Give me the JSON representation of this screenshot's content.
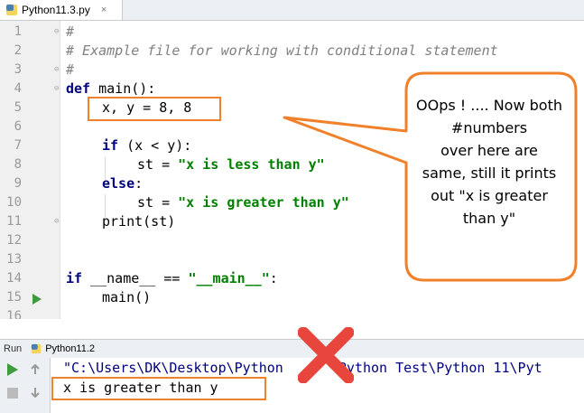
{
  "tab": {
    "filename": "Python11.3.py",
    "close_glyph": "×"
  },
  "editor": {
    "line_numbers": [
      "1",
      "2",
      "3",
      "4",
      "5",
      "6",
      "7",
      "8",
      "9",
      "10",
      "11",
      "12",
      "13",
      "14",
      "15",
      "16"
    ]
  },
  "code": {
    "l1": "#",
    "l2": "# Example file for working with conditional statement",
    "l3": "#",
    "l4_kw": "def",
    "l4_rest": " main():",
    "l5": "x, y = 8, 8",
    "l7_kw": "if",
    "l7_rest": " (x < y):",
    "l8_pre": "st = ",
    "l8_str": "\"x is less than y\"",
    "l9_kw": "else",
    "l9_rest": ":",
    "l10_pre": "st = ",
    "l10_str": "\"x is greater than y\"",
    "l11": "print(st)",
    "l14_kw": "if",
    "l14_mid": " __name__ == ",
    "l14_str": "\"__main__\"",
    "l14_end": ":",
    "l15": "main()"
  },
  "annotation": {
    "text_lines": [
      "OOps ! .... Now both",
      "#numbers",
      "over here are",
      "same, still it prints",
      "out \"x is greater",
      "than y\""
    ],
    "accent_color": "#f0802a"
  },
  "run_panel": {
    "label": "Run",
    "config": "Python11.2",
    "command": "\"C:\\Users\\DK\\Desktop\\Python",
    "command_tail": "\\Python Test\\Python 11\\Pyt",
    "output": "x is greater than y"
  },
  "icons": [
    "python-file-icon",
    "run-gutter-icon",
    "run-icon",
    "stop-icon",
    "scroll-up-icon",
    "scroll-down-icon",
    "red-x-icon"
  ],
  "colors": {
    "keyword": "#000080",
    "string": "#008000",
    "comment": "#808080",
    "highlight": "#f0802a",
    "error": "#e8453c",
    "run": "#3e9c3e"
  }
}
